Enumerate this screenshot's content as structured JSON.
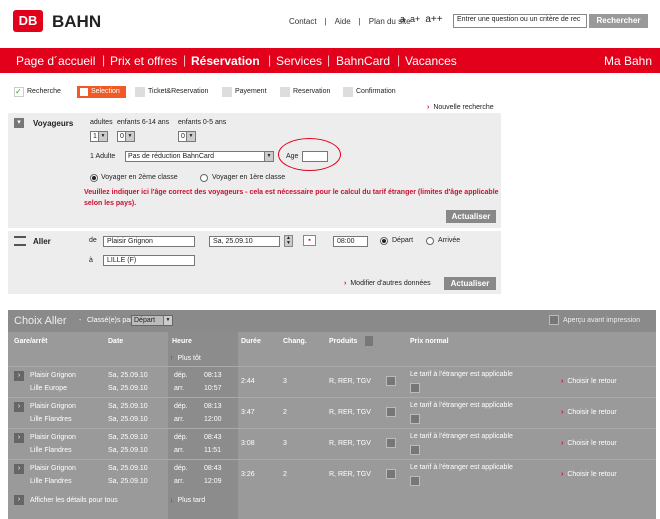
{
  "header": {
    "logo_text": "DB",
    "brand": "BAHN",
    "links": [
      "Contact",
      "|",
      "Aide",
      "|",
      "Plan du site"
    ],
    "font_sizes": [
      "a",
      "a+",
      "a++"
    ],
    "search_value": "Entrer une question ou un critère de rec",
    "search_button": "Rechercher"
  },
  "nav": {
    "items": [
      "Page d´accueil",
      "Prix et offres",
      "Réservation",
      "Services",
      "BahnCard",
      "Vacances"
    ],
    "right": "Ma Bahn",
    "active": "Réservation"
  },
  "steps": [
    "Recherche",
    "Selection",
    "Ticket&Reservation",
    "Payement",
    "Reservation",
    "Confirmation"
  ],
  "new_search": "Nouvelle recherche",
  "travellers": {
    "title": "Voyageurs",
    "adults_label": "adultes",
    "children1_label": "enfants 6-14 ans",
    "children2_label": "enfants 0-5 ans",
    "adults_value": "1",
    "children1_value": "0",
    "children2_value": "0",
    "person_label": "1 Adulte",
    "reduction_value": "Pas de réduction BahnCard",
    "age_label": "Age",
    "class2": "Voyager en 2ème classe",
    "class1": "Voyager en 1ère classe",
    "warning": "Veuillez indiquer ici l'âge correct des voyageurs - cela est nécessaire pour le calcul du tarif étranger (limites d'âge applicable selon les pays).",
    "update": "Actualiser"
  },
  "outbound": {
    "title": "Aller",
    "from_label": "de",
    "from_value": "Plaisir Grignon",
    "date_value": "Sa, 25.09.10",
    "time_value": "08:00",
    "depart_label": "Départ",
    "arrival_label": "Arrivée",
    "to_label": "à",
    "to_value": "LILLE (F)",
    "modify_link": "Modifier d'autres données",
    "update": "Actualiser"
  },
  "results": {
    "title": "Choix Aller",
    "dash": "-",
    "sort_label": "Classé(e)s par",
    "sort_value": "Départ",
    "preview": "Aperçu avant impression",
    "headers": [
      "Gare/arrêt",
      "Date",
      "Heure",
      "Durée",
      "Chang.",
      "Produits",
      "Prix normal"
    ],
    "earlier": "Plus tôt",
    "later": "Plus tard",
    "show_details": "Afficher les détails pour tous",
    "dep_label": "dép.",
    "arr_label": "arr.",
    "rows": [
      {
        "from": "Plaisir Grignon",
        "to": "Lille Europe",
        "date1": "Sa, 25.09.10",
        "date2": "Sa, 25.09.10",
        "dep": "08:13",
        "arr": "10:57",
        "duration": "2:44",
        "changes": "3",
        "products": "R, RER, TGV",
        "price": "Le tarif à l'étranger est applicable",
        "action": "Choisir le retour"
      },
      {
        "from": "Plaisir Grignon",
        "to": "Lille Flandres",
        "date1": "Sa, 25.09.10",
        "date2": "Sa, 25.09.10",
        "dep": "08:13",
        "arr": "12:00",
        "duration": "3:47",
        "changes": "2",
        "products": "R, RER, TGV",
        "price": "Le tarif à l'étranger est applicable",
        "action": "Choisir le retour"
      },
      {
        "from": "Plaisir Grignon",
        "to": "Lille Flandres",
        "date1": "Sa, 25.09.10",
        "date2": "Sa, 25.09.10",
        "dep": "08:43",
        "arr": "11:51",
        "duration": "3:08",
        "changes": "3",
        "products": "R, RER, TGV",
        "price": "Le tarif à l'étranger est applicable",
        "action": "Choisir le retour"
      },
      {
        "from": "Plaisir Grignon",
        "to": "Lille Flandres",
        "date1": "Sa, 25.09.10",
        "date2": "Sa, 25.09.10",
        "dep": "08:43",
        "arr": "12:09",
        "duration": "3:26",
        "changes": "2",
        "products": "R, RER, TGV",
        "price": "Le tarif à l'étranger est applicable",
        "action": "Choisir le retour"
      }
    ]
  },
  "colors": {
    "brand_red": "#e2001a",
    "step_active": "#f15a24",
    "overlay_gray": "#9a9a9a"
  }
}
